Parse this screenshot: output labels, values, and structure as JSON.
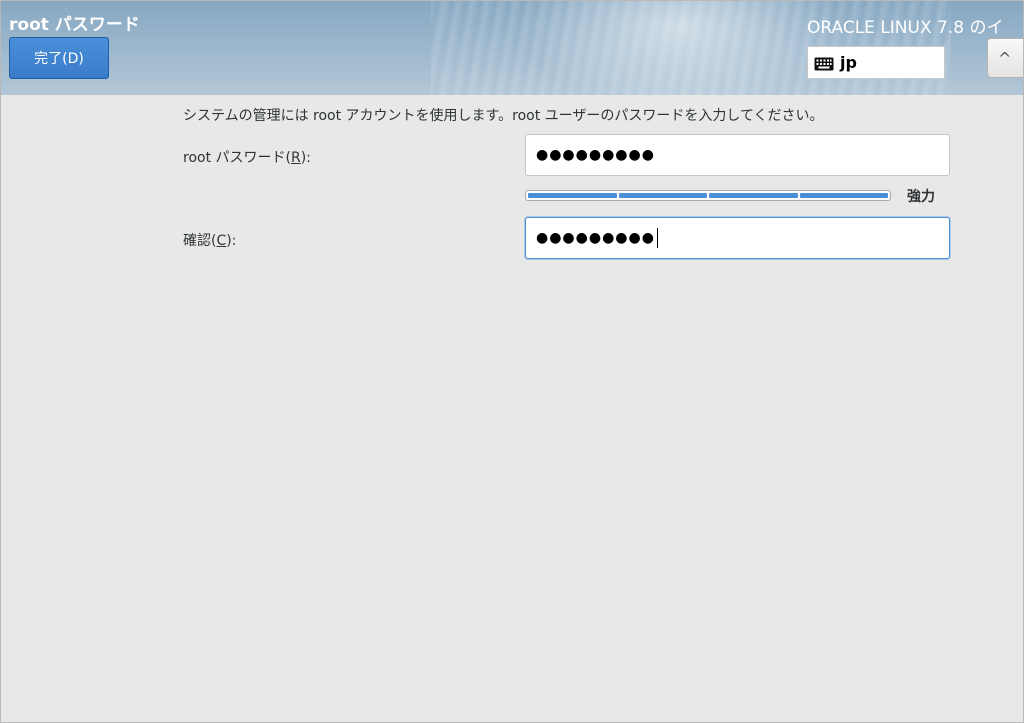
{
  "header": {
    "title": "root パスワード",
    "done_button": "完了(D)",
    "product_title": "ORACLE LINUX 7.8 のイ",
    "keyboard_layout": "jp",
    "help_glyph": "^"
  },
  "content": {
    "description": "システムの管理には root アカウントを使用します。root ユーザーのパスワードを入力してください。",
    "password_label_prefix": "root パスワード(",
    "password_label_mnemonic": "R",
    "password_label_suffix": "):",
    "password_value": "●●●●●●●●●",
    "strength": {
      "label": "強力",
      "level": 1.0,
      "color": "#4a90d9"
    },
    "confirm_label_prefix": "確認(",
    "confirm_label_mnemonic": "C",
    "confirm_label_suffix": "):",
    "confirm_value": "●●●●●●●●●"
  },
  "colors": {
    "accent": "#4a90d9",
    "header_bg": "#9ab6cc",
    "background": "#e8e8e7"
  }
}
